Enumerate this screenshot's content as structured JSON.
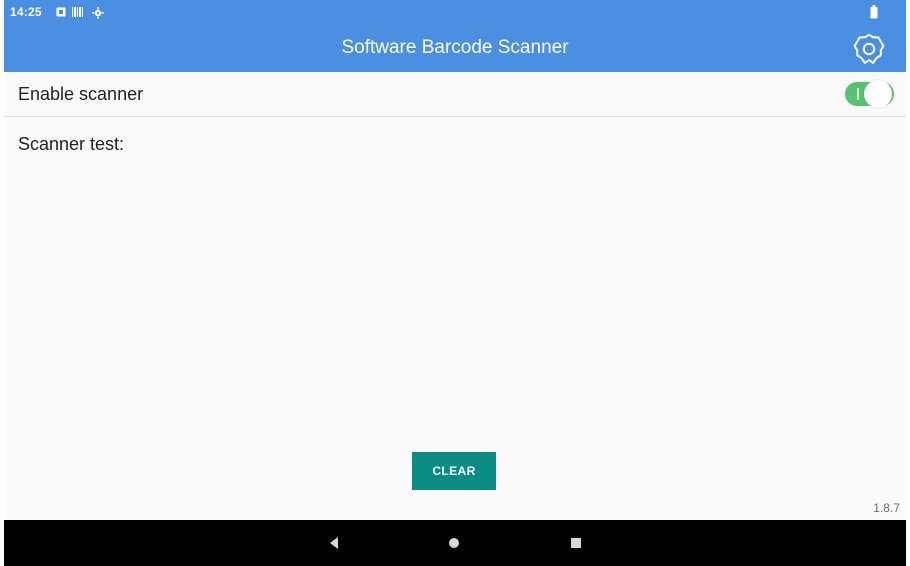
{
  "status_bar": {
    "time": "14:25",
    "icons": [
      "notification-icon",
      "barcode-icon",
      "settings-gear-icon",
      "battery-icon"
    ]
  },
  "app_bar": {
    "title": "Software Barcode Scanner",
    "settings_icon": "settings-icon"
  },
  "settings": {
    "enable_label": "Enable scanner",
    "enable_state": true
  },
  "scanner": {
    "test_label": "Scanner test:"
  },
  "actions": {
    "clear_label": "CLEAR"
  },
  "footer": {
    "version": "1.8.7"
  },
  "navigation": {
    "icons": [
      "back-icon",
      "home-icon",
      "recents-icon"
    ]
  },
  "colors": {
    "primary": "#4b8fe3",
    "switch_on": "#58c36e",
    "button": "#0a8b84",
    "background": "#fafafa"
  }
}
